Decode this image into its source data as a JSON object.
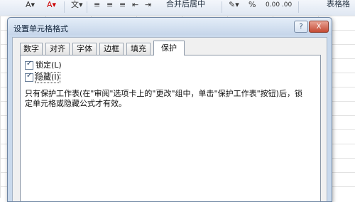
{
  "ribbon": {
    "merge_label": "合并后居中",
    "percent_label": "%",
    "table_label": "表格格",
    "decimal_label": "0.00 .00"
  },
  "dialog": {
    "title": "设置单元格格式",
    "help_label": "?",
    "close_label": "X",
    "tabs": [
      {
        "label": "数字"
      },
      {
        "label": "对齐"
      },
      {
        "label": "字体"
      },
      {
        "label": "边框"
      },
      {
        "label": "填充"
      },
      {
        "label": "保护"
      }
    ],
    "active_tab": "保护",
    "locked": {
      "label": "锁定(L)",
      "checked": true
    },
    "hidden": {
      "label": "隐藏(I)",
      "checked": true
    },
    "description": "只有保护工作表(在\"审阅\"选项卡上的\"更改\"组中，单击\"保护工作表\"按钮)后，锁定单元格或隐藏公式才有效。"
  }
}
